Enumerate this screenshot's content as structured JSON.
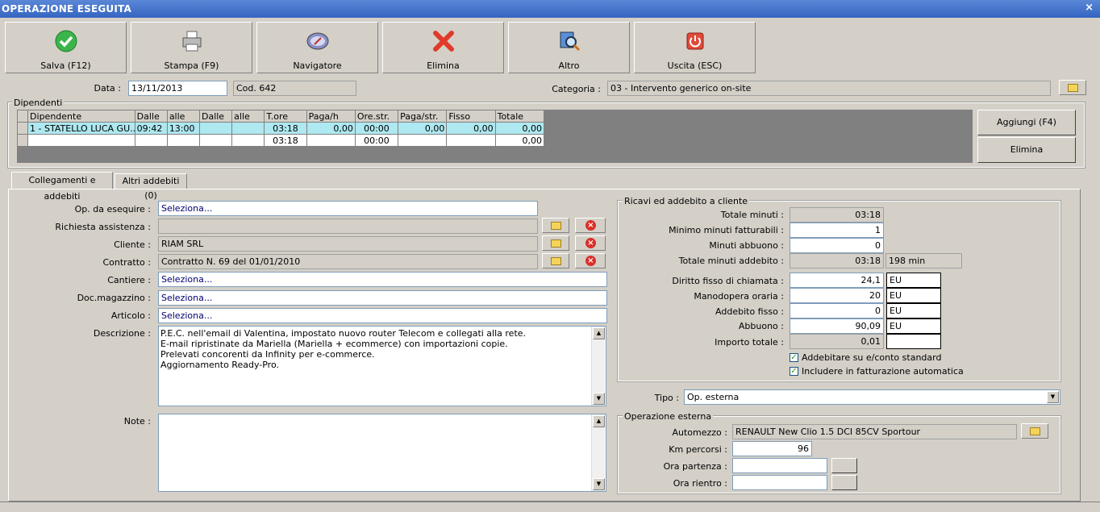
{
  "window": {
    "title": "OPERAZIONE ESEGUITA",
    "close": "×"
  },
  "toolbar": {
    "buttons": [
      {
        "label": "Salva (F12)",
        "icon": "check-icon"
      },
      {
        "label": "Stampa (F9)",
        "icon": "printer-icon"
      },
      {
        "label": "Navigatore",
        "icon": "compass-icon"
      },
      {
        "label": "Elimina",
        "icon": "delete-x-icon"
      },
      {
        "label": "Altro",
        "icon": "magnifier-icon"
      },
      {
        "label": "Uscita (ESC)",
        "icon": "power-icon"
      }
    ]
  },
  "header": {
    "data_label": "Data :",
    "data_value": "13/11/2013",
    "cod": "Cod. 642",
    "categoria_label": "Categoria :",
    "categoria_value": "03 - Intervento generico on-site"
  },
  "dipendenti": {
    "title": "Dipendenti",
    "columns": [
      "Dipendente",
      "Dalle",
      "alle",
      "Dalle",
      "alle",
      "T.ore",
      "Paga/h",
      "Ore.str.",
      "Paga/str.",
      "Fisso",
      "Totale"
    ],
    "rows": [
      [
        "1 - STATELLO LUCA GU...",
        "09:42",
        "13:00",
        "",
        "",
        "03:18",
        "0,00",
        "00:00",
        "0,00",
        "0,00",
        "0,00"
      ],
      [
        "",
        "",
        "",
        "",
        "",
        "03:18",
        "",
        "00:00",
        "",
        "",
        "0,00"
      ]
    ],
    "add_button": "Aggiungi (F4)",
    "delete_button": "Elimina"
  },
  "tabs": [
    {
      "label": "Collegamenti e addebiti"
    },
    {
      "label": "Altri addebiti (0)"
    }
  ],
  "left": {
    "op_label": "Op. da esequire :",
    "op_value": "Seleziona...",
    "richiesta_label": "Richiesta assistenza :",
    "richiesta_value": "",
    "cliente_label": "Cliente :",
    "cliente_value": "RIAM SRL",
    "contratto_label": "Contratto :",
    "contratto_value": "Contratto N. 69 del 01/01/2010",
    "cantiere_label": "Cantiere :",
    "cantiere_value": "Seleziona...",
    "doc_label": "Doc.magazzino :",
    "doc_value": "Seleziona...",
    "articolo_label": "Articolo :",
    "articolo_value": "Seleziona...",
    "descrizione_label": "Descrizione :",
    "descrizione_lines": [
      "P.E.C. nell'email di Valentina, impostato nuovo router Telecom e collegati alla rete.",
      "E-mail ripristinate da Mariella (Mariella + ecommerce) con importazioni copie.",
      "Prelevati concorenti da Infinity per e-commerce.",
      "Aggiornamento Ready-Pro."
    ],
    "note_label": "Note :"
  },
  "ricavi": {
    "title": "Ricavi ed addebito a cliente",
    "totale_minuti_label": "Totale minuti :",
    "totale_minuti": "03:18",
    "minimo_label": "Minimo minuti fatturabili :",
    "minimo": "1",
    "abbuono_min_label": "Minuti abbuono :",
    "abbuono_min": "0",
    "tot_addebito_label": "Totale minuti addebito :",
    "tot_addebito": "03:18",
    "tot_addebito_min": "198 min",
    "diritto_label": "Diritto fisso di chiamata :",
    "diritto": "24,1",
    "diritto_cur": "EU",
    "manodopera_label": "Manodopera oraria :",
    "manodopera": "20",
    "manodopera_cur": "EU",
    "addebito_label": "Addebito fisso :",
    "addebito": "0",
    "addebito_cur": "EU",
    "abbuono_label": "Abbuono :",
    "abbuono": "90,09",
    "abbuono_cur": "EU",
    "importo_label": "Importo totale :",
    "importo": "0,01",
    "chk1": "Addebitare su e/conto standard",
    "chk2": "Includere in fatturazione automatica"
  },
  "tipo": {
    "label": "Tipo :",
    "value": "Op. esterna"
  },
  "esterna": {
    "title": "Operazione esterna",
    "automezzo_label": "Automezzo :",
    "automezzo": "RENAULT New Clio 1.5 DCI 85CV Sportour",
    "km_label": "Km percorsi :",
    "km": "96",
    "partenza_label": "Ora partenza :",
    "partenza": "",
    "rientro_label": "Ora rientro :",
    "rientro": ""
  }
}
